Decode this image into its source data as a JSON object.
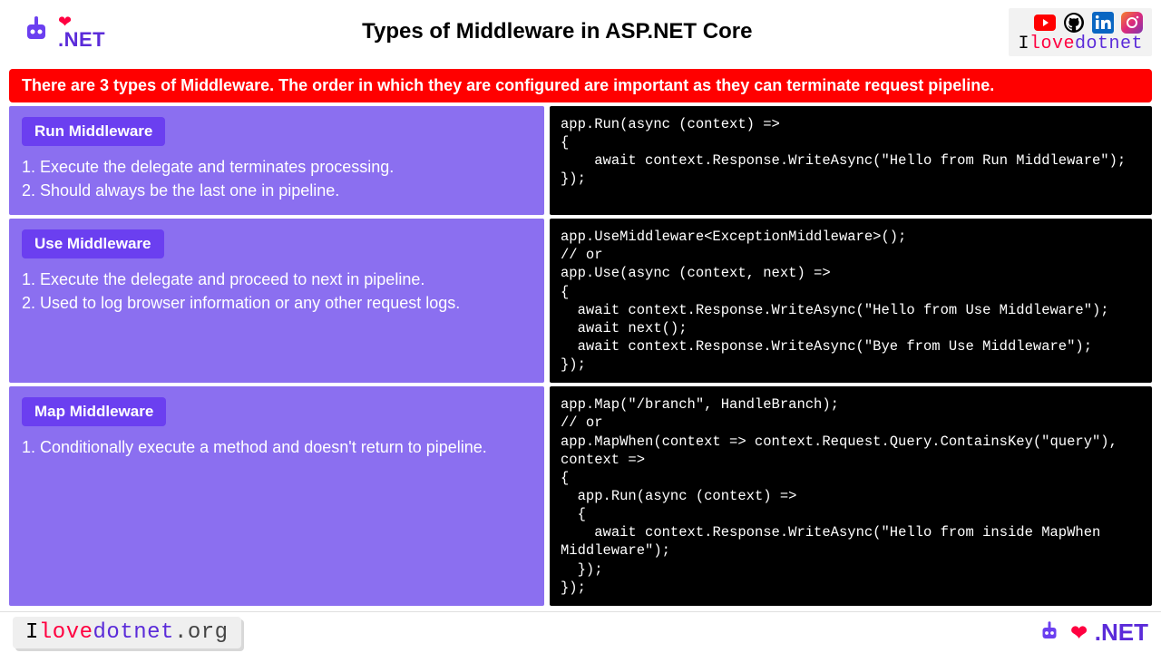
{
  "header": {
    "title": "Types of Middleware in ASP.NET Core",
    "logo_text": ".NET",
    "brand": {
      "i": "I",
      "love": "love",
      "dotnet": "dotnet"
    }
  },
  "banner": "There are 3 types of Middleware. The order in which they are configured are important as they can terminate request pipeline.",
  "sections": [
    {
      "badge": "Run Middleware",
      "points": [
        "Execute the delegate and terminates processing.",
        "Should always be the last one in pipeline."
      ],
      "code": "app.Run(async (context) =>\n{\n    await context.Response.WriteAsync(\"Hello from Run Middleware\");\n});"
    },
    {
      "badge": "Use Middleware",
      "points": [
        "Execute the delegate and proceed to next in pipeline.",
        "Used to log browser information or any other request logs."
      ],
      "code": "app.UseMiddleware<ExceptionMiddleware>();\n// or\napp.Use(async (context, next) =>\n{\n  await context.Response.WriteAsync(\"Hello from Use Middleware\");\n  await next();\n  await context.Response.WriteAsync(\"Bye from Use Middleware\");\n});"
    },
    {
      "badge": "Map Middleware",
      "points": [
        " Conditionally execute a method and doesn't return to pipeline."
      ],
      "code": "app.Map(\"/branch\", HandleBranch);\n// or\napp.MapWhen(context => context.Request.Query.ContainsKey(\"query\"), context =>\n{\n  app.Run(async (context) =>\n  {\n    await context.Response.WriteAsync(\"Hello from inside MapWhen Middleware\");\n  });\n});"
    }
  ],
  "footer": {
    "brand": {
      "i": "I",
      "love": "love",
      "dotnet": "dotnet",
      "org": ".org"
    },
    "right_text": ".NET"
  }
}
